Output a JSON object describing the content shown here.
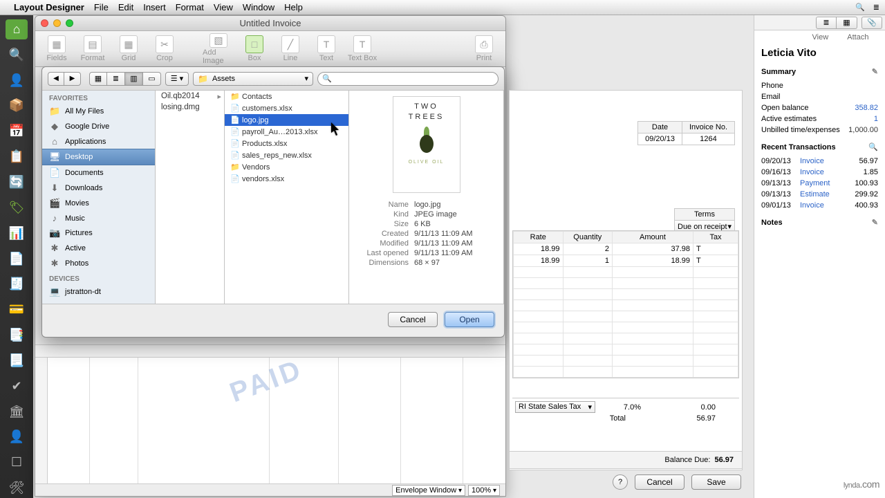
{
  "menubar": {
    "app": "Layout Designer",
    "items": [
      "File",
      "Edit",
      "Insert",
      "Format",
      "View",
      "Window",
      "Help"
    ]
  },
  "doc_window": {
    "title": "Untitled Invoice",
    "toolbar": [
      {
        "label": "Fields",
        "icon": "▦"
      },
      {
        "label": "Format",
        "icon": "▤"
      },
      {
        "label": "Grid",
        "icon": "▦"
      },
      {
        "label": "Crop",
        "icon": "✂"
      },
      {
        "label": "Add Image",
        "icon": "▧",
        "active": false
      },
      {
        "label": "Box",
        "icon": "□",
        "active": true
      },
      {
        "label": "Line",
        "icon": "╱"
      },
      {
        "label": "Text",
        "icon": "T"
      },
      {
        "label": "Text Box",
        "icon": "T"
      },
      {
        "label": "Print",
        "icon": "⎙"
      }
    ],
    "paid_stamp": "PAID",
    "zoom_template": "Envelope Window",
    "zoom_pct": "100%"
  },
  "open_dialog": {
    "path_label": "Assets",
    "sidebar": {
      "favorites_label": "FAVORITES",
      "favorites": [
        {
          "icon": "📁",
          "label": "All My Files"
        },
        {
          "icon": "◆",
          "label": "Google Drive"
        },
        {
          "icon": "⌂",
          "label": "Applications"
        },
        {
          "icon": "🖥",
          "label": "Desktop",
          "selected": true
        },
        {
          "icon": "📄",
          "label": "Documents"
        },
        {
          "icon": "⬇",
          "label": "Downloads"
        },
        {
          "icon": "🎬",
          "label": "Movies"
        },
        {
          "icon": "♪",
          "label": "Music"
        },
        {
          "icon": "📷",
          "label": "Pictures"
        },
        {
          "icon": "✱",
          "label": "Active"
        },
        {
          "icon": "✱",
          "label": "Photos"
        }
      ],
      "devices_label": "DEVICES",
      "devices": [
        {
          "icon": "💻",
          "label": "jstratton-dt"
        }
      ]
    },
    "col1": [
      "Oil.qb2014",
      "losing.dmg"
    ],
    "col2": [
      {
        "name": "Contacts",
        "folder": true
      },
      {
        "name": "customers.xlsx"
      },
      {
        "name": "logo.jpg",
        "selected": true
      },
      {
        "name": "payroll_Au…2013.xlsx"
      },
      {
        "name": "Products.xlsx"
      },
      {
        "name": "sales_reps_new.xlsx"
      },
      {
        "name": "Vendors",
        "folder": true
      },
      {
        "name": "vendors.xlsx"
      }
    ],
    "preview": {
      "logo_line1": "TWO",
      "logo_line2": "TREES",
      "logo_tag": "OLIVE OIL",
      "meta": [
        {
          "k": "Name",
          "v": "logo.jpg"
        },
        {
          "k": "Kind",
          "v": "JPEG image"
        },
        {
          "k": "Size",
          "v": "6 KB"
        },
        {
          "k": "Created",
          "v": "9/11/13 11:09 AM"
        },
        {
          "k": "Modified",
          "v": "9/11/13 11:09 AM"
        },
        {
          "k": "Last opened",
          "v": "9/11/13 11:09 AM"
        },
        {
          "k": "Dimensions",
          "v": "68 × 97"
        }
      ]
    },
    "cancel": "Cancel",
    "open": "Open"
  },
  "invoice": {
    "head": {
      "date_lbl": "Date",
      "date": "09/20/13",
      "no_lbl": "Invoice No.",
      "no": "1264"
    },
    "terms_lbl": "Terms",
    "terms_value": "Due on receipt",
    "cols": [
      "Rate",
      "Quantity",
      "Amount",
      "Tax"
    ],
    "lines": [
      {
        "rate": "18.99",
        "qty": "2",
        "amount": "37.98",
        "tax": "T"
      },
      {
        "rate": "18.99",
        "qty": "1",
        "amount": "18.99",
        "tax": "T"
      }
    ],
    "tax_name": "RI State Sales Tax",
    "tax_pct": "7.0%",
    "tax_amt": "0.00",
    "total_lbl": "Total",
    "total": "56.97",
    "balance_lbl": "Balance Due:",
    "balance": "56.97",
    "cancel": "Cancel",
    "save": "Save"
  },
  "info": {
    "customer": "Leticia Vito",
    "summary_lbl": "Summary",
    "fields": [
      {
        "k": "Phone",
        "v": ""
      },
      {
        "k": "Email",
        "v": ""
      },
      {
        "k": "Open balance",
        "v": "358.82",
        "blue": true
      },
      {
        "k": "Active estimates",
        "v": "1",
        "blue": true
      },
      {
        "k": "Unbilled time/expenses",
        "v": "1,000.00"
      }
    ],
    "recent_lbl": "Recent Transactions",
    "transactions": [
      {
        "d": "09/20/13",
        "t": "Invoice",
        "a": "56.97"
      },
      {
        "d": "09/16/13",
        "t": "Invoice",
        "a": "1.85"
      },
      {
        "d": "09/13/13",
        "t": "Payment",
        "a": "100.93"
      },
      {
        "d": "09/13/13",
        "t": "Estimate",
        "a": "299.92"
      },
      {
        "d": "09/01/13",
        "t": "Invoice",
        "a": "400.93"
      }
    ],
    "notes_lbl": "Notes",
    "view_lbl": "View",
    "attach_lbl": "Attach"
  },
  "watermark": "lynda",
  "watermark_suffix": ".com"
}
